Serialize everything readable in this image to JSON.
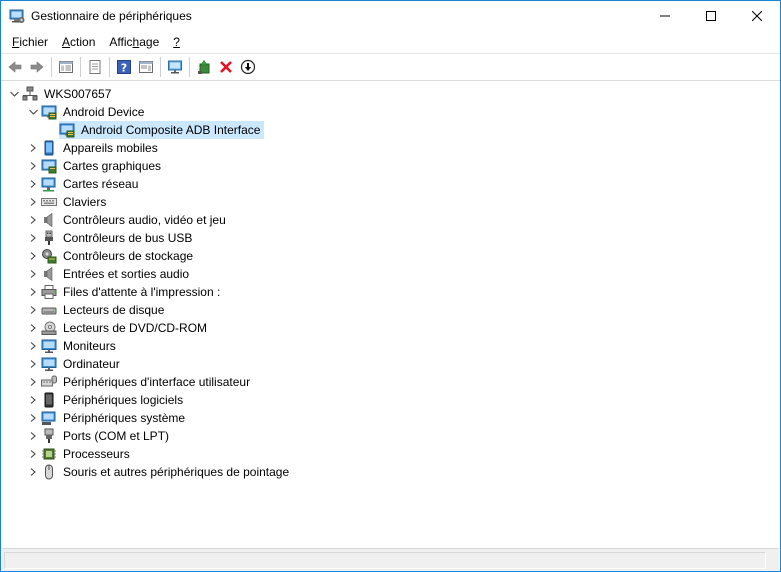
{
  "window": {
    "title": "Gestionnaire de périphériques"
  },
  "menu": [
    {
      "label": "Fichier",
      "accel": "F"
    },
    {
      "label": "Action",
      "accel": "A"
    },
    {
      "label": "Affichage",
      "accel": "h"
    },
    {
      "label": "?",
      "accel": "?"
    }
  ],
  "toolbar": [
    "back-icon",
    "forward-icon",
    "sep",
    "properties-view-icon",
    "sep",
    "print-doc-icon",
    "sep",
    "help-icon",
    "view-detail-icon",
    "sep",
    "monitor-scan-icon",
    "sep",
    "update-driver-icon",
    "uninstall-icon",
    "disable-download-icon"
  ],
  "tree": {
    "root": {
      "label": "WKS007657",
      "icon": "computer-root-icon"
    },
    "android": {
      "label": "Android Device",
      "icon": "android-device-icon",
      "children": [
        {
          "label": "Android Composite ADB Interface",
          "icon": "adb-interface-icon",
          "selected": true
        }
      ]
    },
    "categories": [
      {
        "label": "Appareils mobiles",
        "icon": "mobile-device-icon"
      },
      {
        "label": "Cartes graphiques",
        "icon": "display-adapter-icon"
      },
      {
        "label": "Cartes réseau",
        "icon": "network-adapter-icon"
      },
      {
        "label": "Claviers",
        "icon": "keyboard-icon"
      },
      {
        "label": "Contrôleurs audio, vidéo et jeu",
        "icon": "audio-speaker-icon"
      },
      {
        "label": "Contrôleurs de bus USB",
        "icon": "usb-icon"
      },
      {
        "label": "Contrôleurs de stockage",
        "icon": "storage-controller-icon"
      },
      {
        "label": "Entrées et sorties audio",
        "icon": "audio-io-icon"
      },
      {
        "label": "Files d'attente à l'impression :",
        "icon": "printer-icon"
      },
      {
        "label": "Lecteurs de disque",
        "icon": "disk-drive-icon"
      },
      {
        "label": "Lecteurs de DVD/CD-ROM",
        "icon": "dvd-drive-icon"
      },
      {
        "label": "Moniteurs",
        "icon": "monitor-icon"
      },
      {
        "label": "Ordinateur",
        "icon": "computer-icon"
      },
      {
        "label": "Périphériques d'interface utilisateur",
        "icon": "hid-icon"
      },
      {
        "label": "Périphériques logiciels",
        "icon": "software-device-icon"
      },
      {
        "label": "Périphériques système",
        "icon": "system-device-icon"
      },
      {
        "label": "Ports (COM et LPT)",
        "icon": "port-icon"
      },
      {
        "label": "Processeurs",
        "icon": "processor-icon"
      },
      {
        "label": "Souris et autres périphériques de pointage",
        "icon": "mouse-icon"
      }
    ]
  },
  "colors": {
    "selection": "#cce8ff",
    "accent": "#1883d7",
    "uninstall": "#e81123"
  }
}
